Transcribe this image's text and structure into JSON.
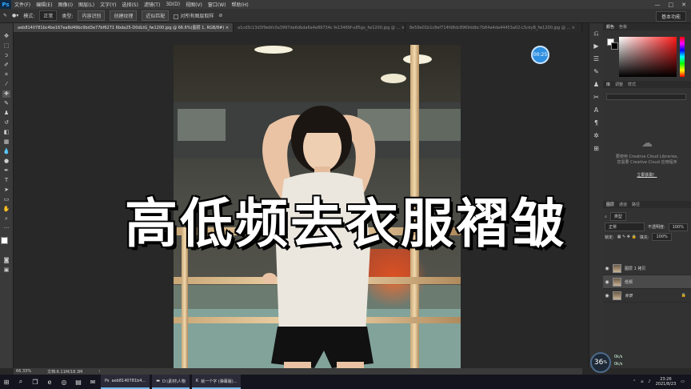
{
  "menubar": {
    "logo": "Ps",
    "items": [
      "文件(F)",
      "编辑(E)",
      "图像(I)",
      "图层(L)",
      "文字(Y)",
      "选择(S)",
      "滤镜(T)",
      "3D(D)",
      "视图(V)",
      "窗口(W)",
      "帮助(H)"
    ],
    "window_controls": [
      "—",
      "□",
      "✕"
    ]
  },
  "options": {
    "mode_label": "模式:",
    "mode_value": "正常",
    "type_label": "类型:",
    "type_value": "内容识别",
    "texture_button": "创建纹理",
    "approx_button": "近似匹配",
    "sample_all_label": "对所有图层取样",
    "workspace": "基本功能"
  },
  "tabs": [
    {
      "label": "aeb8140781bc4be167ea8d49bc9bd3e77bf6271 6bda25-D0dLtG_fw1200.jpg @ 66.6%(图层 1, RGB/8#) ×",
      "active": true
    },
    {
      "label": "a1cd3c13d3f9ebfc0a3997da6dbda6a4e89734c fe13469f-u85gx_fw1200.jpg @ ... ×",
      "active": false
    },
    {
      "label": "8e59e01b1c8ef714fd8dc8969ddbc7b64a4da44453a02-L5ckyB_fw1200.jpg @ ... ×",
      "active": false
    }
  ],
  "canvas": {
    "overlay_title": "高低频去衣服褶皱",
    "timer": "00:25"
  },
  "status": {
    "zoom": "66.33%",
    "doc": "文档:6.11M/18.3M",
    "arrow": "›"
  },
  "color_panel": {
    "tabs": [
      "颜色",
      "色板"
    ]
  },
  "library_panel": {
    "tabs": [
      "库",
      "调整",
      "样式"
    ],
    "message_line1": "要使用 Creative Cloud Libraries,",
    "message_line2": "您需要 Creative Cloud 应用程序",
    "link": "立即获取！"
  },
  "layers_panel": {
    "tabs": [
      "图层",
      "通道",
      "路径"
    ],
    "filter_label": "类型",
    "blend_mode": "正常",
    "opacity_label": "不透明度:",
    "opacity_value": "100%",
    "lock_label": "锁定:",
    "fill_label": "填充:",
    "fill_value": "100%",
    "layers": [
      {
        "name": "图层 1 拷贝",
        "selected": false
      },
      {
        "name": "低频",
        "selected": true
      },
      {
        "name": "背景",
        "selected": false
      }
    ]
  },
  "overlay_widget": {
    "percent": "36",
    "unit": "%",
    "up": "0k/s",
    "down": "0k/s"
  },
  "taskbar": {
    "apps": [
      {
        "label": "aeb8140781b4..."
      },
      {
        "label": "D:\\素材\\人物"
      },
      {
        "label": "就一个字 (弹幕版)..."
      }
    ],
    "time": "23:26",
    "date": "2021/8/23"
  }
}
